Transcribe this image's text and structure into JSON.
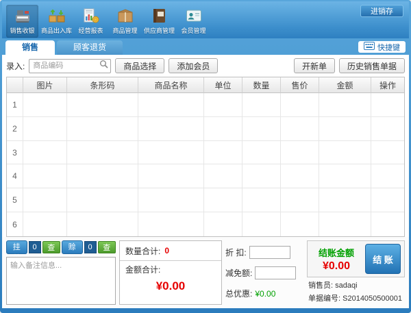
{
  "titlebar": {
    "stock_button": "进销存"
  },
  "toolbar": {
    "items": [
      {
        "label": "销售收银"
      },
      {
        "label": "商品出入库"
      },
      {
        "label": "经营报表"
      },
      {
        "label": "商品管理"
      },
      {
        "label": "供应商管理"
      },
      {
        "label": "会员管理"
      }
    ]
  },
  "tabs": {
    "sales": "销售",
    "returns": "顾客退货",
    "hotkeys": "快捷键"
  },
  "entry": {
    "label": "录入:",
    "code_placeholder": "商品编码",
    "select_product": "商品选择",
    "add_member": "添加会员",
    "new_order": "开新单",
    "history": "历史销售单据"
  },
  "table": {
    "headers": [
      "图片",
      "条形码",
      "商品名称",
      "单位",
      "数量",
      "售价",
      "金额",
      "操作"
    ],
    "row_numbers": [
      "1",
      "2",
      "3",
      "4",
      "5",
      "6"
    ]
  },
  "bottom": {
    "hold_label": "挂单",
    "hold_count": "0",
    "hold_view": "查看",
    "credit_label": "赊账",
    "credit_count": "0",
    "credit_view": "查看",
    "remark_placeholder": "输入备注信息...",
    "qty_total_label": "数量合计:",
    "qty_total_value": "0",
    "amount_total_label": "金额合计:",
    "amount_total_value": "¥0.00",
    "discount_label": "折 扣:",
    "reduction_label": "减免额:",
    "promo_label": "总优惠:",
    "promo_value": "¥0.00",
    "checkout_label": "结账金额",
    "checkout_amount": "¥0.00",
    "checkout_button": "结 账",
    "seller_label": "销售员:",
    "seller_value": "sadaqi",
    "doc_label": "单据编号:",
    "doc_value": "S2014050500001"
  },
  "colors": {
    "accent_blue": "#2b7cbd",
    "value_red": "#e60000",
    "value_green": "#00a000"
  }
}
